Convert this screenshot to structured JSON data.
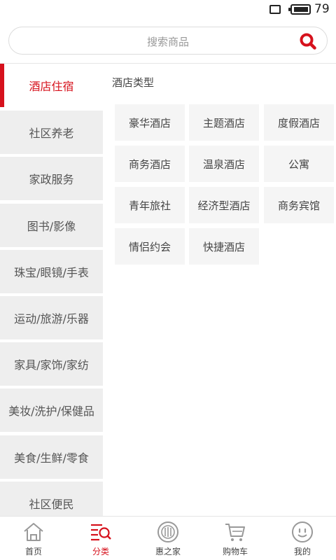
{
  "status_bar": {
    "battery_level": "79"
  },
  "search": {
    "placeholder": "搜索商品"
  },
  "sidebar": {
    "items": [
      {
        "label": "酒店住宿",
        "active": true
      },
      {
        "label": "社区养老",
        "active": false
      },
      {
        "label": "家政服务",
        "active": false
      },
      {
        "label": "图书/影像",
        "active": false
      },
      {
        "label": "珠宝/眼镜/手表",
        "active": false
      },
      {
        "label": "运动/旅游/乐器",
        "active": false
      },
      {
        "label": "家具/家饰/家纺",
        "active": false
      },
      {
        "label": "美妆/洗护/保健品",
        "active": false
      },
      {
        "label": "美食/生鲜/零食",
        "active": false
      },
      {
        "label": "社区便民",
        "active": false
      }
    ]
  },
  "content": {
    "section_title": "酒店类型",
    "tags": [
      "豪华酒店",
      "主题酒店",
      "度假酒店",
      "商务酒店",
      "温泉酒店",
      "公寓",
      "青年旅社",
      "经济型酒店",
      "商务宾馆",
      "情侣约会",
      "快捷酒店"
    ]
  },
  "tab_bar": {
    "tabs": [
      {
        "label": "首页",
        "icon": "home-icon",
        "active": false
      },
      {
        "label": "分类",
        "icon": "category-icon",
        "active": true
      },
      {
        "label": "惠之家",
        "icon": "hui-home-icon",
        "active": false
      },
      {
        "label": "购物车",
        "icon": "cart-icon",
        "active": false
      },
      {
        "label": "我的",
        "icon": "profile-icon",
        "active": false
      }
    ]
  },
  "colors": {
    "accent": "#d6111c",
    "sidebar_bg": "#eeeeee",
    "tag_bg": "#f5f5f5"
  }
}
